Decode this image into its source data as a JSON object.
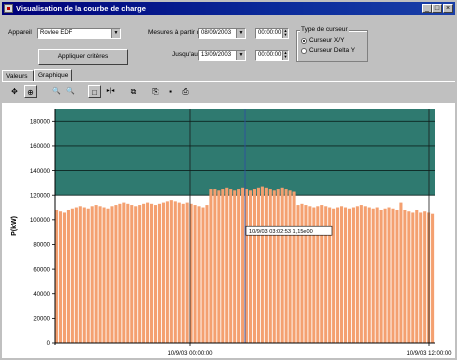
{
  "window": {
    "title": "Visualisation de la courbe de charge",
    "controls": [
      "_",
      "□",
      "×"
    ]
  },
  "form": {
    "appareil_label": "Appareil",
    "appareil_value": "Rovlee EDF",
    "from_label": "Mesures à partir du",
    "from_date": "08/09/2003",
    "from_time": "00:00:00",
    "to_label": "Jusqu'au",
    "to_date": "13/09/2003",
    "to_time": "00:00:00",
    "apply_button": "Appliquer critères",
    "cursor_group_title": "Type de curseur",
    "cursor_options": [
      "Curseur X/Y",
      "Curseur Delta Y"
    ]
  },
  "tabs": [
    "Valeurs",
    "Graphique"
  ],
  "toolbar": {
    "icons": [
      "pan-icon",
      "crosshair-icon",
      "zoom-out-icon",
      "zoom-in-icon",
      "box-select-icon",
      "split-cursor-icon",
      "export-icon",
      "copy-icon",
      "save-icon",
      "print-icon"
    ],
    "glyphs": [
      "✥",
      "⊕",
      "🔍",
      "🔍",
      "□",
      "▸|◂",
      "⧉",
      "⎘",
      "▪",
      "⎙"
    ]
  },
  "chart_data": {
    "type": "bar",
    "ylabel": "P(kW)",
    "ylim": [
      0,
      190000
    ],
    "yticks": [
      "0",
      "20000",
      "40000",
      "60000",
      "80000",
      "100000",
      "120000",
      "140000",
      "160000",
      "180000"
    ],
    "yvals": [
      0,
      20000,
      40000,
      60000,
      80000,
      100000,
      120000,
      140000,
      160000,
      180000
    ],
    "xticks": [
      "10/9/03 00:00:00",
      "10/9/03 12:00:00"
    ],
    "cursor_label": "10/9/03 03:02:53  1,15e00",
    "threshold": 120000,
    "colors": {
      "bars": "#f4a070",
      "bar_edge": "#fbd8c0",
      "over": "#2f7a70",
      "under": "#ffffff"
    },
    "values": [
      108000,
      107000,
      106000,
      108000,
      109000,
      110000,
      111000,
      110000,
      109000,
      111000,
      112000,
      111000,
      110000,
      109000,
      111000,
      112000,
      113000,
      114000,
      113000,
      112000,
      111000,
      112000,
      113000,
      114000,
      113000,
      112000,
      113000,
      114000,
      115000,
      116000,
      115000,
      114000,
      113000,
      114000,
      113000,
      112000,
      111000,
      110000,
      112000,
      125000,
      125000,
      124000,
      125000,
      126000,
      125000,
      124000,
      125000,
      126000,
      125000,
      124000,
      125000,
      126000,
      127000,
      126000,
      125000,
      124000,
      125000,
      126000,
      125000,
      124000,
      123000,
      112000,
      113000,
      112000,
      111000,
      110000,
      111000,
      112000,
      111000,
      110000,
      109000,
      110000,
      111000,
      110000,
      109000,
      110000,
      111000,
      112000,
      111000,
      110000,
      109000,
      110000,
      108000,
      109000,
      110000,
      109000,
      108000,
      114000,
      108000,
      107000,
      106000,
      108000,
      106000,
      107000,
      106000,
      105000
    ]
  }
}
